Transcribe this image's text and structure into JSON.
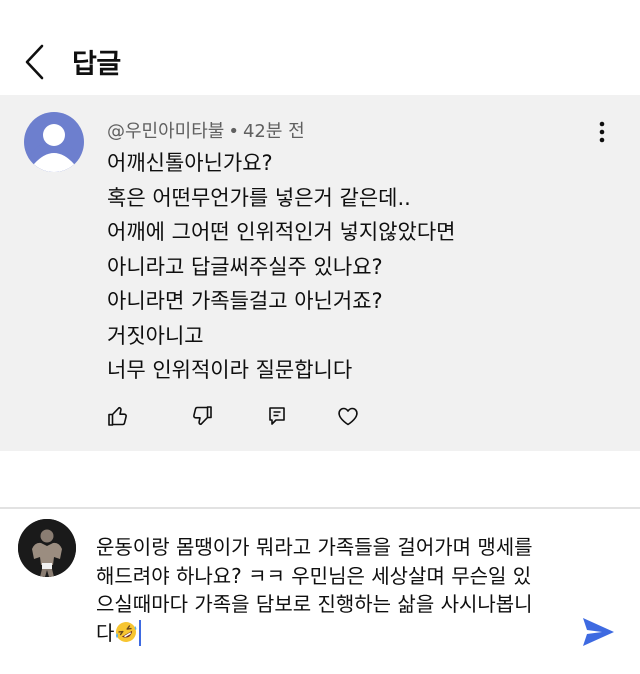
{
  "header": {
    "title": "답글",
    "back_icon": "chevron-left-icon"
  },
  "comment": {
    "author": "@우민아미타불",
    "separator": "•",
    "time": "42분 전",
    "lines": [
      "어깨신톨아닌가요?",
      "혹은 어떤무언가를 넣은거 같은데..",
      "어깨에 그어떤 인위적인거 넣지않았다면",
      "아니라고 답글써주실주 있나요?",
      "아니라면 가족들걸고 아닌거죠?",
      "거짓아니고",
      "너무 인위적이라 질문합니다"
    ],
    "actions": [
      "like-icon",
      "dislike-icon",
      "reply-icon",
      "heart-icon"
    ],
    "avatar_color": "#6d7fce",
    "background": "#f1f1f1"
  },
  "reply_input": {
    "lines": [
      "운동이랑 몸땡이가 뭐라고 가족들을 걸어가며 맹세를",
      "해드려야 하나요? ㅋㅋ 우민님은 세상살며 무슨일 있",
      "으실때마다 가족을 담보로 진행하는 삶을 사시나봅니",
      "다"
    ],
    "emoji": "rolling-on-floor-laughing-emoji",
    "send_icon": "send-icon",
    "accent_color": "#3e6ae1"
  }
}
